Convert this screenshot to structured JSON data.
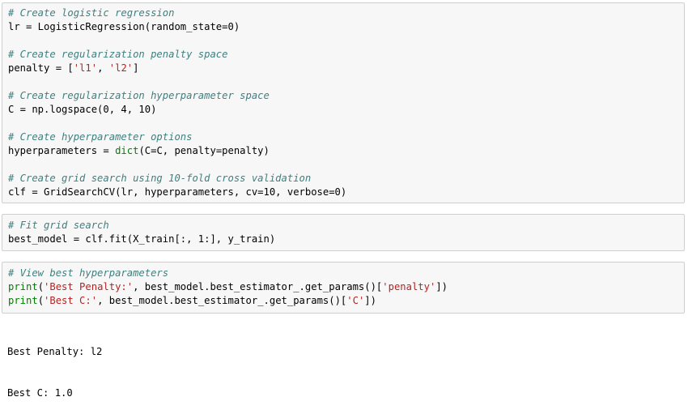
{
  "cells": [
    {
      "lines": [
        [
          {
            "t": "c",
            "v": "# Create logistic regression"
          }
        ],
        [
          {
            "t": "n",
            "v": "lr = LogisticRegression(random_state=0)"
          }
        ],
        [],
        [
          {
            "t": "c",
            "v": "# Create regularization penalty space"
          }
        ],
        [
          {
            "t": "n",
            "v": "penalty = ["
          },
          {
            "t": "s",
            "v": "'l1'"
          },
          {
            "t": "n",
            "v": ", "
          },
          {
            "t": "s",
            "v": "'l2'"
          },
          {
            "t": "n",
            "v": "]"
          }
        ],
        [],
        [
          {
            "t": "c",
            "v": "# Create regularization hyperparameter space"
          }
        ],
        [
          {
            "t": "n",
            "v": "C = np.logspace(0, 4, 10)"
          }
        ],
        [],
        [
          {
            "t": "c",
            "v": "# Create hyperparameter options"
          }
        ],
        [
          {
            "t": "n",
            "v": "hyperparameters = "
          },
          {
            "t": "b",
            "v": "dict"
          },
          {
            "t": "n",
            "v": "(C=C, penalty=penalty)"
          }
        ],
        [],
        [
          {
            "t": "c",
            "v": "# Create grid search using 10-fold cross validation"
          }
        ],
        [
          {
            "t": "n",
            "v": "clf = GridSearchCV(lr, hyperparameters, cv=10, verbose=0)"
          }
        ]
      ]
    },
    {
      "lines": [
        [
          {
            "t": "c",
            "v": "# Fit grid search"
          }
        ],
        [
          {
            "t": "n",
            "v": "best_model = clf.fit(X_train[:, 1:], y_train)"
          }
        ]
      ]
    },
    {
      "lines": [
        [
          {
            "t": "c",
            "v": "# View best hyperparameters"
          }
        ],
        [
          {
            "t": "b",
            "v": "print"
          },
          {
            "t": "n",
            "v": "("
          },
          {
            "t": "s",
            "v": "'Best Penalty:'"
          },
          {
            "t": "n",
            "v": ", best_model.best_estimator_.get_params()["
          },
          {
            "t": "s",
            "v": "'penalty'"
          },
          {
            "t": "n",
            "v": "])"
          }
        ],
        [
          {
            "t": "b",
            "v": "print"
          },
          {
            "t": "n",
            "v": "("
          },
          {
            "t": "s",
            "v": "'Best C:'"
          },
          {
            "t": "n",
            "v": ", best_model.best_estimator_.get_params()["
          },
          {
            "t": "s",
            "v": "'C'"
          },
          {
            "t": "n",
            "v": "])"
          }
        ]
      ]
    }
  ],
  "output": {
    "line1": "Best Penalty: l2",
    "line2": "Best C: 1.0"
  }
}
